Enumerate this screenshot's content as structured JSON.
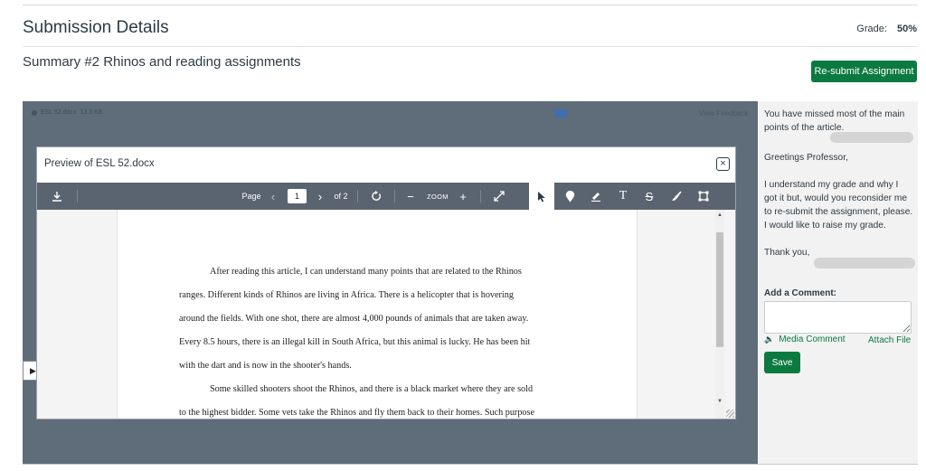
{
  "header": {
    "title": "Submission Details",
    "grade_label": "Grade:",
    "grade_value": "50%"
  },
  "assignment": {
    "title": "Summary #2 Rhinos and reading assignments",
    "resubmit_label": "Re-submit Assignment"
  },
  "viewer": {
    "file_name": "ESL 52.docx",
    "file_size": "13.3 KB",
    "view_feedback": "View Feedback"
  },
  "preview": {
    "title": "Preview of ESL 52.docx",
    "close_label": "×",
    "toolbar": {
      "page_label": "Page",
      "page_value": "1",
      "page_total": "of 2",
      "zoom_label": "ZOOM"
    },
    "document_lines": [
      "After reading this article, I can understand many points that are related to the Rhinos",
      "ranges. Different kinds of Rhinos are living in Africa. There is a helicopter that is hovering",
      "around the fields. With one shot, there are almost 4,000 pounds of animals that are taken away.",
      "Every 8.5 hours, there is an illegal kill in South Africa, but this animal is lucky. He has been hit",
      "with the dart and is now in the shooter's hands.",
      "Some skilled shooters shoot the Rhinos, and there is a black market where they are sold",
      "to the highest bidder. Some vets take the Rhinos and fly them back to their homes. Such purpose"
    ]
  },
  "comments": {
    "teacher_comment": "You have missed most of the main points of the article.",
    "student_greeting": "Greetings Professor,",
    "student_body": "I understand my grade and why I got it but, would you reconsider me to re-submit the assignment, please. I would like to raise my grade.",
    "student_signoff": "Thank you,",
    "add_comment_label": "Add a Comment:",
    "media_comment_label": "Media Comment",
    "attach_file_label": "Attach File",
    "save_label": "Save"
  },
  "colors": {
    "accent_green": "#0b7a40",
    "viewer_bg": "#5f6d7a",
    "toolbar_bg": "#5a6470",
    "panel_bg": "#f2f2f2"
  }
}
